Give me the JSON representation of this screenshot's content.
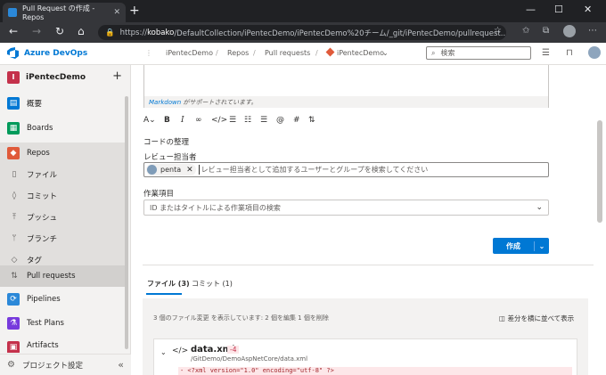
{
  "browser": {
    "tab_title": "Pull Request の作成 - Repos",
    "tab_close": "✕",
    "new_tab": "+",
    "url_host": "kobako",
    "url_prefix": "https://",
    "url_rest": "/DefaultCollection/iPentecDemo/iPentecDemo%20チーム/_git/iPentecDemo/pullrequest...",
    "window": {
      "minimize": "—",
      "maximize": "☐",
      "close": "✕"
    }
  },
  "header": {
    "brand": "Azure DevOps",
    "breadcrumbs": [
      "iPentecDemo",
      "Repos",
      "Pull requests",
      "iPentecDemo"
    ],
    "search_placeholder": "検索"
  },
  "sidebar": {
    "project_initial": "I",
    "project_name": "iPentecDemo",
    "items": [
      {
        "label": "概要",
        "icon": "overview-icon",
        "color": "#0078d4"
      },
      {
        "label": "Boards",
        "icon": "boards-icon",
        "color": "#009a5a"
      },
      {
        "label": "Repos",
        "icon": "repos-icon",
        "color": "#e05a3a"
      },
      {
        "label": "ファイル",
        "icon": "file-icon"
      },
      {
        "label": "コミット",
        "icon": "commit-icon"
      },
      {
        "label": "プッシュ",
        "icon": "push-icon"
      },
      {
        "label": "ブランチ",
        "icon": "branch-icon"
      },
      {
        "label": "タグ",
        "icon": "tag-icon"
      },
      {
        "label": "Pull requests",
        "icon": "pull-request-icon"
      },
      {
        "label": "Pipelines",
        "icon": "pipelines-icon",
        "color": "#2b88d8"
      },
      {
        "label": "Test Plans",
        "icon": "test-plans-icon",
        "color": "#773adc"
      },
      {
        "label": "Artifacts",
        "icon": "artifacts-icon",
        "color": "#c4314b"
      }
    ],
    "settings_label": "プロジェクト設定"
  },
  "form": {
    "markdown_note_link": "Markdown",
    "markdown_note_text": " がサポートされています。",
    "description_text": "コードの整理",
    "reviewers_label": "レビュー担当者",
    "reviewer_name": "penta",
    "reviewers_placeholder": "レビュー担当者として追加するユーザーとグループを検索してください",
    "work_items_label": "作業項目",
    "work_items_placeholder": "ID またはタイトルによる作業項目の検索",
    "create_button": "作成"
  },
  "files": {
    "tabs": [
      "ファイル (3)",
      "コミット (1)"
    ],
    "summary": "3 個のファイル変更 を表示しています:  2 個を編集   1 個を削除",
    "side_by_side": "差分を横に並べて表示",
    "file_name": "data.xml",
    "file_deletions": "-4",
    "file_path": "/GitDemo/DemoAspNetCore/data.xml",
    "diff_line": "- <?xml version=\"1.0\" encoding=\"utf-8\" ?>"
  }
}
